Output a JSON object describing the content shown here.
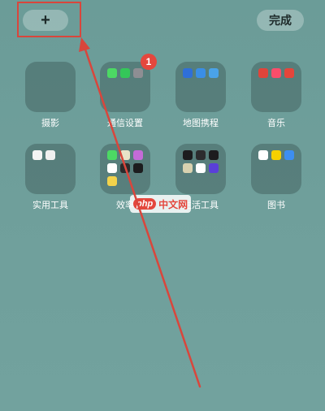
{
  "toolbar": {
    "add_label": "+",
    "done_label": "完成"
  },
  "folders": [
    {
      "label": "摄影",
      "badge": ""
    },
    {
      "label": "通信设置",
      "badge": "1"
    },
    {
      "label": "地图携程",
      "badge": ""
    },
    {
      "label": "音乐",
      "badge": ""
    },
    {
      "label": "实用工具",
      "badge": ""
    },
    {
      "label": "效率",
      "badge": ""
    },
    {
      "label": "生活工具",
      "badge": ""
    },
    {
      "label": "图书",
      "badge": ""
    }
  ],
  "watermark": {
    "logo": "php",
    "text": "中文网"
  },
  "colors": {
    "background": "#6f9e9a",
    "annotation": "#d9463c",
    "badge": "#e4473d"
  }
}
